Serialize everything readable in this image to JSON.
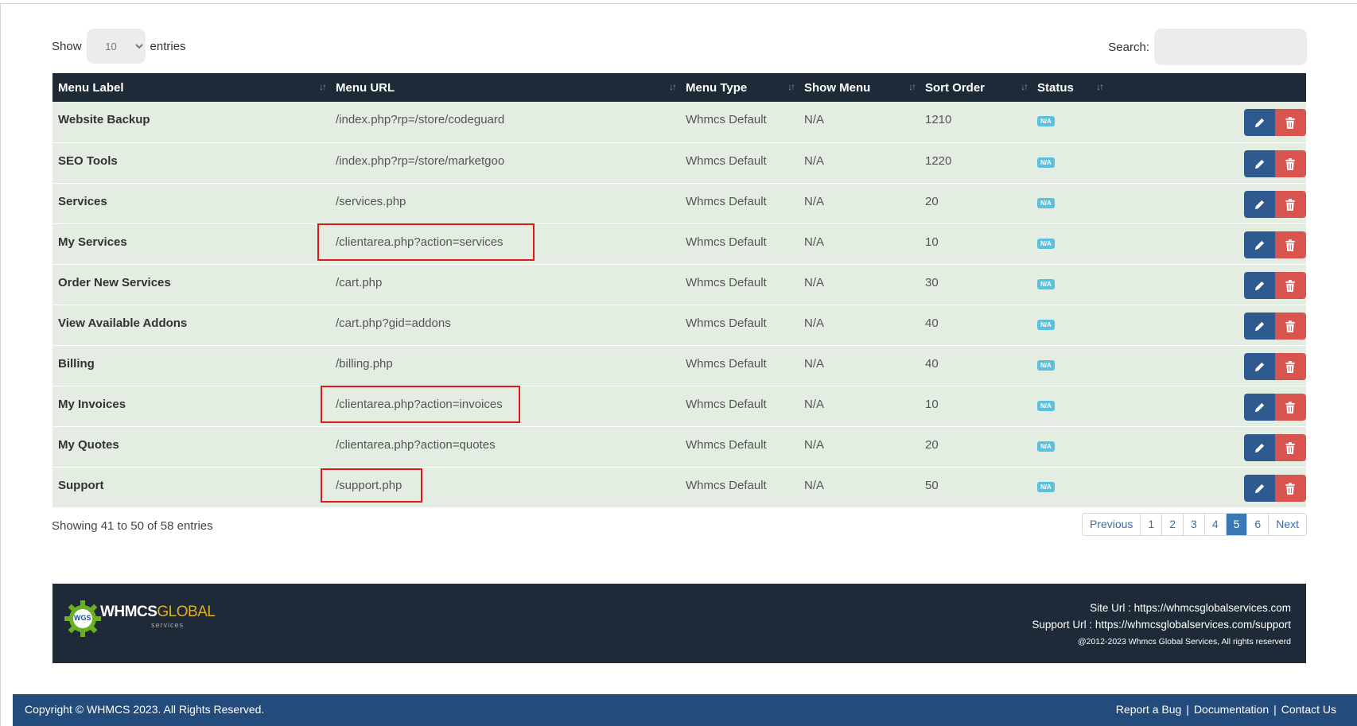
{
  "controls": {
    "show_label": "Show",
    "entries_value": "10",
    "entries_label": "entries",
    "search_label": "Search:",
    "search_value": ""
  },
  "table": {
    "columns": [
      "Menu Label",
      "Menu URL",
      "Menu Type",
      "Show Menu",
      "Sort Order",
      "Status"
    ],
    "rows": [
      {
        "label": "Website Backup",
        "url": "/index.php?rp=/store/codeguard",
        "type": "Whmcs Default",
        "show": "N/A",
        "sort": "1210",
        "status": "N/A"
      },
      {
        "label": "SEO Tools",
        "url": "/index.php?rp=/store/marketgoo",
        "type": "Whmcs Default",
        "show": "N/A",
        "sort": "1220",
        "status": "N/A"
      },
      {
        "label": "Services",
        "url": "/services.php",
        "type": "Whmcs Default",
        "show": "N/A",
        "sort": "20",
        "status": "N/A"
      },
      {
        "label": "My Services",
        "url": "/clientarea.php?action=services",
        "type": "Whmcs Default",
        "show": "N/A",
        "sort": "10",
        "status": "N/A"
      },
      {
        "label": "Order New Services",
        "url": "/cart.php",
        "type": "Whmcs Default",
        "show": "N/A",
        "sort": "30",
        "status": "N/A"
      },
      {
        "label": "View Available Addons",
        "url": "/cart.php?gid=addons",
        "type": "Whmcs Default",
        "show": "N/A",
        "sort": "40",
        "status": "N/A"
      },
      {
        "label": "Billing",
        "url": "/billing.php",
        "type": "Whmcs Default",
        "show": "N/A",
        "sort": "40",
        "status": "N/A"
      },
      {
        "label": "My Invoices",
        "url": "/clientarea.php?action=invoices",
        "type": "Whmcs Default",
        "show": "N/A",
        "sort": "10",
        "status": "N/A"
      },
      {
        "label": "My Quotes",
        "url": "/clientarea.php?action=quotes",
        "type": "Whmcs Default",
        "show": "N/A",
        "sort": "20",
        "status": "N/A"
      },
      {
        "label": "Support",
        "url": "/support.php",
        "type": "Whmcs Default",
        "show": "N/A",
        "sort": "50",
        "status": "N/A"
      }
    ]
  },
  "info": "Showing 41 to 50 of 58 entries",
  "pagination": {
    "previous": "Previous",
    "pages": [
      "1",
      "2",
      "3",
      "4",
      "5",
      "6"
    ],
    "active": "5",
    "next": "Next"
  },
  "addon_footer": {
    "logo_badge": "WGS",
    "logo_main": "WHMCS",
    "logo_accent": "GLOBAL",
    "logo_sub": "services",
    "site_url": "Site Url : https://whmcsglobalservices.com",
    "support_url": "Support Url : https://whmcsglobalservices.com/support",
    "copyright": "@2012-2023 Whmcs Global Services, All rights reserverd"
  },
  "page_footer": {
    "copyright": "Copyright © WHMCS 2023. All Rights Reserved.",
    "links": [
      "Report a Bug",
      "Documentation",
      "Contact Us"
    ],
    "separator": "|"
  },
  "colors": {
    "header_bg": "#1f2a38",
    "row_bg": "#e3ede2",
    "edit_button": "#2f5a8f",
    "delete_button": "#d9534f",
    "badge": "#5bc0de",
    "highlight": "#e01818",
    "footer_bar": "#234b7c"
  },
  "icons": [
    "sort-icon",
    "pencil-icon",
    "trash-icon",
    "gear-logo-icon"
  ]
}
